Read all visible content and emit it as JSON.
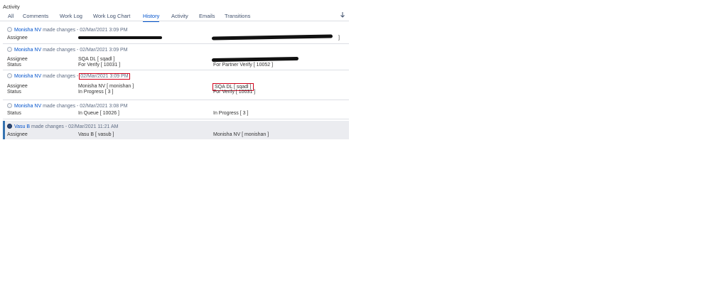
{
  "activity": {
    "title": "Activity"
  },
  "tabs": [
    {
      "label": "All"
    },
    {
      "label": "Comments"
    },
    {
      "label": "Work Log"
    },
    {
      "label": "Work Log Chart"
    },
    {
      "label": "History"
    },
    {
      "label": "Activity"
    },
    {
      "label": "Emails"
    },
    {
      "label": "Transitions"
    }
  ],
  "active_tab": "History",
  "history": [
    {
      "user": "Monisha NV",
      "action": " made changes - ",
      "timestamp": "02/Mar/2021 3:09 PM",
      "rows": [
        {
          "field": "Assignee",
          "old": "",
          "new": "]"
        }
      ]
    },
    {
      "user": "Monisha NV",
      "action": " made changes - ",
      "timestamp": "02/Mar/2021 3:09 PM",
      "rows": [
        {
          "field": "Assignee",
          "old": "SQA DL [ sqadl ]",
          "new": ""
        },
        {
          "field": "Status",
          "old": "For Verify [ 10031 ]",
          "new": "For Partner Verify [ 10052 ]"
        }
      ]
    },
    {
      "user": "Monisha NV",
      "action": " made changes - ",
      "timestamp": "02/Mar/2021 3:09 PM",
      "rows": [
        {
          "field": "Assignee",
          "old": "Monisha NV [ monishan ]",
          "new": "SQA DL [ sqadl ]"
        },
        {
          "field": "Status",
          "old": "In Progress [ 3 ]",
          "new": "For Verify [ 10031 ]"
        }
      ]
    },
    {
      "user": "Monisha NV",
      "action": " made changes - ",
      "timestamp": "02/Mar/2021 3:08 PM",
      "rows": [
        {
          "field": "Status",
          "old": "In Queue [ 10026 ]",
          "new": "In Progress [ 3 ]"
        }
      ]
    },
    {
      "user": "Vasu B",
      "action": " made changes - ",
      "timestamp": "02/Mar/2021 11:21 AM",
      "rows": [
        {
          "field": "Assignee",
          "old": "Vasu B [ vasub ]",
          "new": "Monisha NV [ monishan ]"
        }
      ]
    }
  ]
}
